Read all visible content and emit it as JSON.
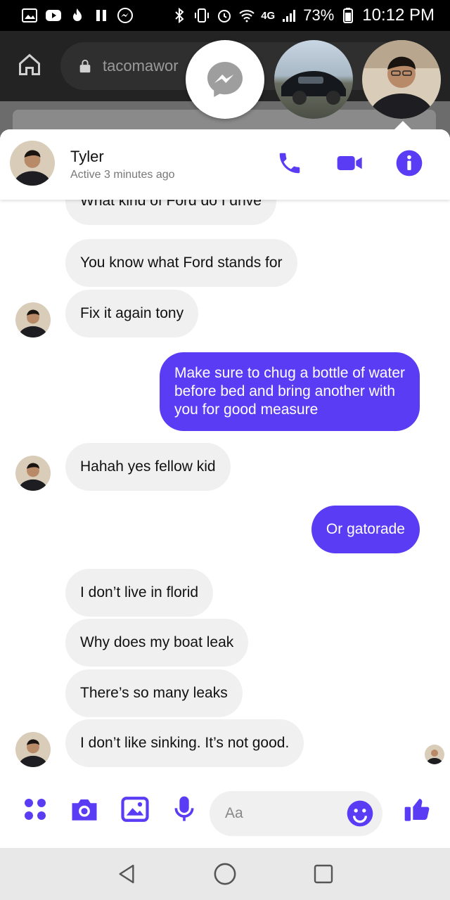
{
  "status_bar": {
    "battery_pct": "73%",
    "network": "4G",
    "time": "10:12 PM"
  },
  "browser": {
    "url_text": "tacomawor"
  },
  "chat": {
    "contact_name": "Tyler",
    "contact_status": "Active 3 minutes ago",
    "accent_color": "#5b3cf5"
  },
  "messages": [
    {
      "from": "them",
      "text": "What kind of Ford do I drive"
    },
    {
      "from": "them",
      "text": "You know what Ford stands for"
    },
    {
      "from": "them",
      "text": "Fix it again tony"
    },
    {
      "from": "me",
      "lines": [
        "Make sure to chug a bottle of water",
        "before bed and bring another with",
        "you for good measure"
      ]
    },
    {
      "from": "them",
      "text": "Hahah yes fellow kid"
    },
    {
      "from": "me",
      "text": "Or gatorade"
    },
    {
      "from": "them",
      "text": "I don’t live in florid"
    },
    {
      "from": "them",
      "text": "Why does my boat leak"
    },
    {
      "from": "them",
      "text": "There’s so many leaks"
    },
    {
      "from": "them",
      "text": "I don’t like sinking. It’s not good."
    }
  ],
  "composer": {
    "placeholder": "Aa"
  },
  "icons": {
    "call": "phone-icon",
    "video": "video-camera-icon",
    "info": "info-icon",
    "more": "four-dots-icon",
    "camera": "camera-icon",
    "gallery": "image-icon",
    "mic": "microphone-icon",
    "emoji": "emoji-icon",
    "like": "thumbs-up-icon"
  }
}
